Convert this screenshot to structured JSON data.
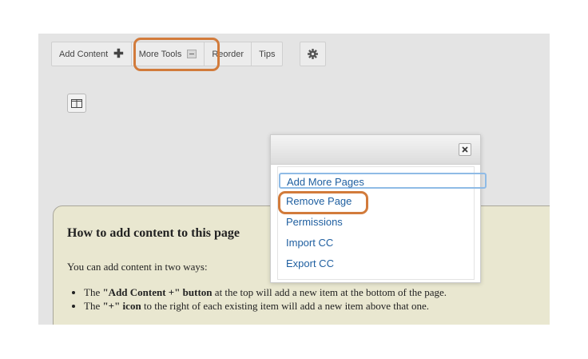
{
  "toolbar": {
    "add_content_label": "Add Content",
    "add_content_icon": "plus-icon",
    "more_tools_label": "More Tools",
    "reorder_label": "Reorder",
    "tips_label": "Tips",
    "settings_icon": "gear-icon"
  },
  "layout_icon": "columns-layout-icon",
  "menu": {
    "close_icon": "close-icon",
    "items": [
      {
        "label": "Add More Pages",
        "state": "focused"
      },
      {
        "label": "Remove Page",
        "state": "highlighted"
      },
      {
        "label": "Permissions"
      },
      {
        "label": "Import CC"
      },
      {
        "label": "Export CC"
      }
    ]
  },
  "help": {
    "title": "How to add content to this page",
    "intro": "You can add content in two ways:",
    "bullet1": {
      "lead": "The ",
      "bold": "\"Add Content +\" button",
      "rest": " at the top will add a new item at the bottom of the page."
    },
    "bullet2": {
      "lead": "The ",
      "bold": "\"+\" icon",
      "rest": " to the right of each existing item will add a new item above that one."
    }
  },
  "colors": {
    "highlight": "#d27b3b",
    "link": "#1f5fa0",
    "info_bg": "#e9e7d0",
    "panel_bg": "#e4e4e4"
  }
}
